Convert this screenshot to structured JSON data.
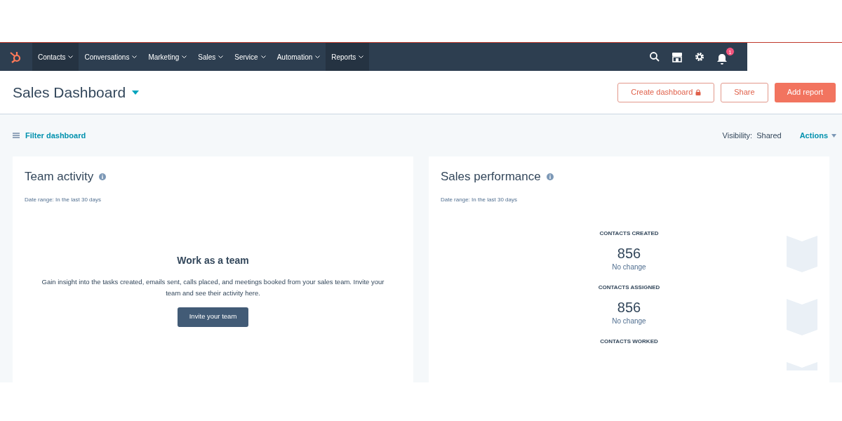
{
  "nav": {
    "items": [
      {
        "label": "Contacts",
        "highlighted": true
      },
      {
        "label": "Conversations",
        "highlighted": false
      },
      {
        "label": "Marketing",
        "highlighted": false
      },
      {
        "label": "Sales",
        "highlighted": false
      },
      {
        "label": "Service",
        "highlighted": false
      },
      {
        "label": "Automation",
        "highlighted": false
      },
      {
        "label": "Reports",
        "highlighted": true
      }
    ],
    "notification_count": "1"
  },
  "header": {
    "title": "Sales Dashboard",
    "buttons": [
      {
        "label": "Create dashboard",
        "kind": "locked"
      },
      {
        "label": "Share",
        "kind": "outline"
      },
      {
        "label": "Add report",
        "kind": "primary"
      }
    ]
  },
  "toolbar": {
    "filter": "Filter dashboard",
    "visibility_label": "Visibility:",
    "visibility_value": "Shared",
    "actions": "Actions"
  },
  "cards": [
    {
      "title": "Team activity",
      "date_range": "Date range: In the last 30 days",
      "kind": "empty",
      "empty_title": "Work as a team",
      "empty_text": "Gain insight into the tasks created, emails sent, calls placed, and meetings booked from your sales team. Invite your team and see their activity here.",
      "button": "Invite your team"
    },
    {
      "title": "Sales performance",
      "date_range": "Date range: In the last 30 days",
      "kind": "metrics",
      "metrics": [
        {
          "label": "CONTACTS CREATED",
          "value": "856",
          "change": "No change"
        },
        {
          "label": "CONTACTS ASSIGNED",
          "value": "856",
          "change": "No change"
        },
        {
          "label": "CONTACTS WORKED"
        }
      ]
    }
  ]
}
